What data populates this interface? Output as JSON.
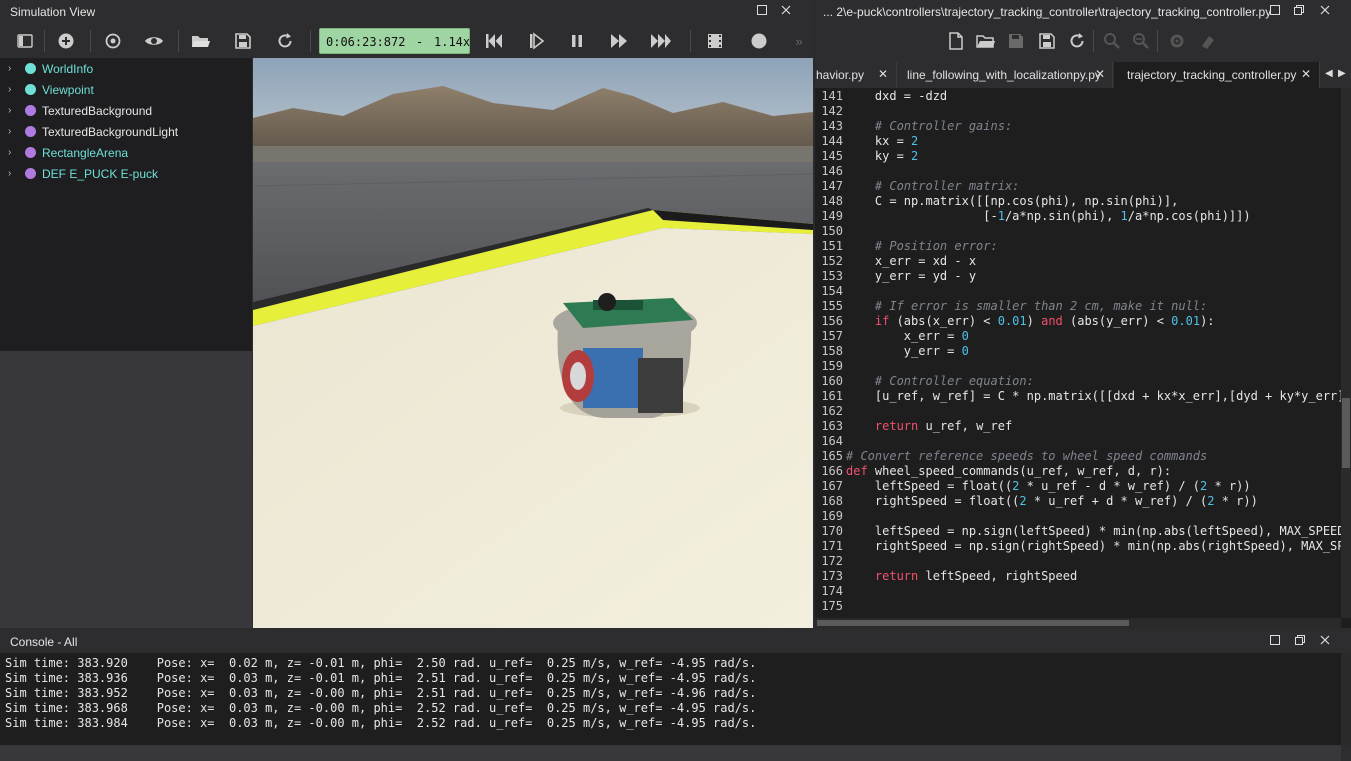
{
  "sim": {
    "title": "Simulation View",
    "clock": {
      "time": "0:06:23:872",
      "dash": "-",
      "speed": "1.14x"
    },
    "tree": [
      {
        "label": "WorldInfo",
        "color": "#6ee0d6",
        "dot": "#6ee0d6"
      },
      {
        "label": "Viewpoint",
        "color": "#6ee0d6",
        "dot": "#6ee0d6"
      },
      {
        "label": "TexturedBackground",
        "color": "#e6e6e6",
        "dot": "#b07be0"
      },
      {
        "label": "TexturedBackgroundLight",
        "color": "#e6e6e6",
        "dot": "#b07be0"
      },
      {
        "label": "RectangleArena",
        "color": "#6ee0d6",
        "dot": "#b07be0"
      },
      {
        "label": "DEF E_PUCK E-puck",
        "color": "#6ee0d6",
        "dot": "#b07be0"
      }
    ]
  },
  "editor": {
    "title": "... 2\\e-puck\\controllers\\trajectory_tracking_controller\\trajectory_tracking_controller.py",
    "tabs": [
      "havior.py",
      "line_following_with_localizationpy.py",
      "trajectory_tracking_controller.py"
    ],
    "code": [
      {
        "n": "141",
        "s": "    dxd = -dzd"
      },
      {
        "n": "142",
        "s": ""
      },
      {
        "n": "143",
        "s": "    # Controller gains:"
      },
      {
        "n": "144",
        "s": "    kx = 2"
      },
      {
        "n": "145",
        "s": "    ky = 2"
      },
      {
        "n": "146",
        "s": ""
      },
      {
        "n": "147",
        "s": "    # Controller matrix:"
      },
      {
        "n": "148",
        "s": "    C = np.matrix([[np.cos(phi), np.sin(phi)],"
      },
      {
        "n": "149",
        "s": "                   [-1/a*np.sin(phi), 1/a*np.cos(phi)]])"
      },
      {
        "n": "150",
        "s": ""
      },
      {
        "n": "151",
        "s": "    # Position error:"
      },
      {
        "n": "152",
        "s": "    x_err = xd - x"
      },
      {
        "n": "153",
        "s": "    y_err = yd - y"
      },
      {
        "n": "154",
        "s": ""
      },
      {
        "n": "155",
        "s": "    # If error is smaller than 2 cm, make it null:"
      },
      {
        "n": "156",
        "s": "    if (abs(x_err) < 0.01) and (abs(y_err) < 0.01):"
      },
      {
        "n": "157",
        "s": "        x_err = 0"
      },
      {
        "n": "158",
        "s": "        y_err = 0"
      },
      {
        "n": "159",
        "s": ""
      },
      {
        "n": "160",
        "s": "    # Controller equation:"
      },
      {
        "n": "161",
        "s": "    [u_ref, w_ref] = C * np.matrix([[dxd + kx*x_err],[dyd + ky*y_err]])"
      },
      {
        "n": "162",
        "s": ""
      },
      {
        "n": "163",
        "s": "    return u_ref, w_ref"
      },
      {
        "n": "164",
        "s": ""
      },
      {
        "n": "165",
        "s": "# Convert reference speeds to wheel speed commands"
      },
      {
        "n": "166",
        "s": "def wheel_speed_commands(u_ref, w_ref, d, r):"
      },
      {
        "n": "167",
        "s": "    leftSpeed = float((2 * u_ref - d * w_ref) / (2 * r))"
      },
      {
        "n": "168",
        "s": "    rightSpeed = float((2 * u_ref + d * w_ref) / (2 * r))"
      },
      {
        "n": "169",
        "s": ""
      },
      {
        "n": "170",
        "s": "    leftSpeed = np.sign(leftSpeed) * min(np.abs(leftSpeed), MAX_SPEED)"
      },
      {
        "n": "171",
        "s": "    rightSpeed = np.sign(rightSpeed) * min(np.abs(rightSpeed), MAX_SPEED)"
      },
      {
        "n": "172",
        "s": ""
      },
      {
        "n": "173",
        "s": "    return leftSpeed, rightSpeed"
      },
      {
        "n": "174",
        "s": ""
      },
      {
        "n": "175",
        "s": ""
      }
    ]
  },
  "console": {
    "title": "Console - All",
    "lines": [
      "Sim time: 383.920    Pose: x=  0.02 m, z= -0.01 m, phi=  2.50 rad. u_ref=  0.25 m/s, w_ref= -4.95 rad/s.",
      "Sim time: 383.936    Pose: x=  0.03 m, z= -0.01 m, phi=  2.51 rad. u_ref=  0.25 m/s, w_ref= -4.95 rad/s.",
      "Sim time: 383.952    Pose: x=  0.03 m, z= -0.00 m, phi=  2.51 rad. u_ref=  0.25 m/s, w_ref= -4.96 rad/s.",
      "Sim time: 383.968    Pose: x=  0.03 m, z= -0.00 m, phi=  2.52 rad. u_ref=  0.25 m/s, w_ref= -4.95 rad/s.",
      "Sim time: 383.984    Pose: x=  0.03 m, z= -0.00 m, phi=  2.52 rad. u_ref=  0.25 m/s, w_ref= -4.95 rad/s."
    ]
  },
  "icons": {
    "sim_toolbar": [
      "toggle-scene-tree-icon",
      "add-node-icon",
      "reset-view-icon",
      "view-eye-icon",
      "open-world-icon",
      "save-world-icon",
      "reload-world-icon",
      "step-back-icon",
      "step-icon",
      "pause-icon",
      "run-icon",
      "fast-forward-icon",
      "record-movie-icon",
      "screenshot-icon"
    ],
    "editor_toolbar": [
      "new-file-icon",
      "open-file-icon",
      "save-file-icon",
      "save-all-icon",
      "revert-icon",
      "find-icon",
      "replace-icon",
      "build-icon",
      "clean-icon"
    ]
  }
}
